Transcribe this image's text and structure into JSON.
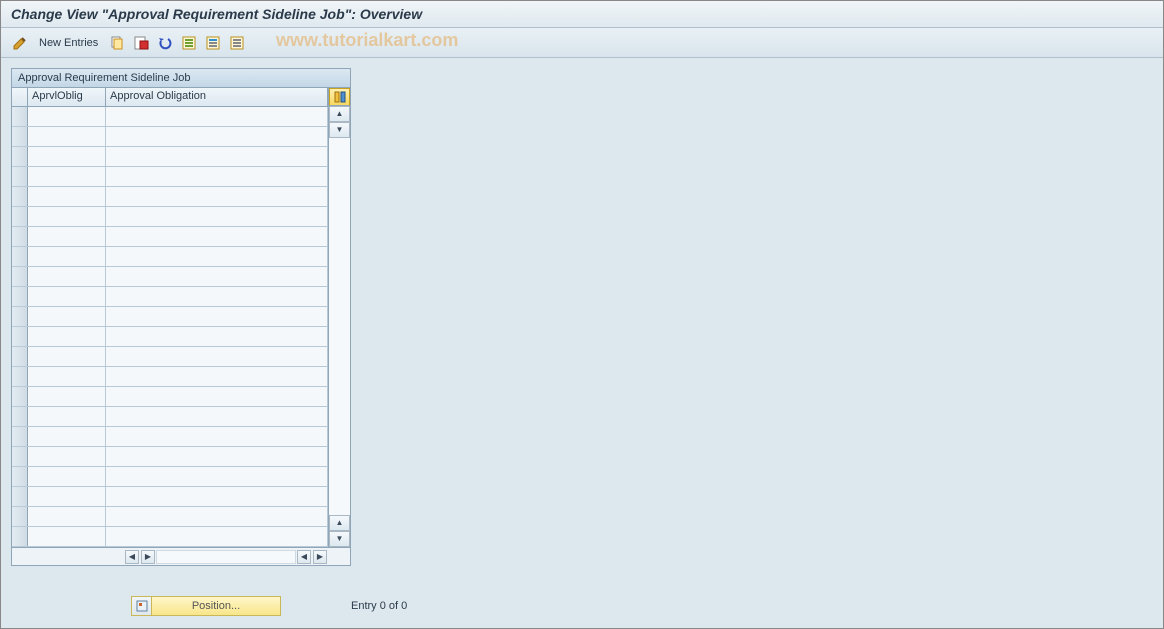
{
  "title": "Change View \"Approval Requirement Sideline Job\": Overview",
  "toolbar": {
    "new_entries": "New Entries"
  },
  "watermark": "www.tutorialkart.com",
  "grid": {
    "title": "Approval Requirement Sideline Job",
    "columns": {
      "c1": "AprvlOblig",
      "c2": "Approval Obligation"
    },
    "row_count": 22
  },
  "footer": {
    "position_label": "Position...",
    "entry_text": "Entry 0 of 0"
  }
}
